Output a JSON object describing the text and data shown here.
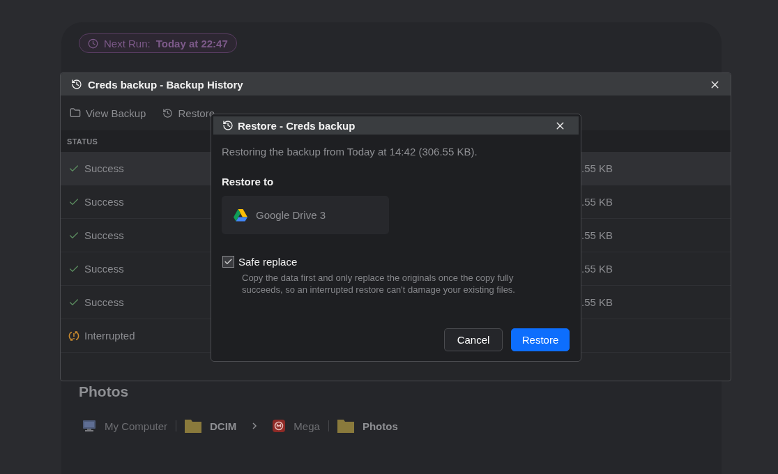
{
  "background": {
    "next_run": {
      "label": "Next Run:",
      "value": "Today at 22:47"
    },
    "section_title": "Photos",
    "breadcrumb": [
      {
        "kind": "computer",
        "label": "My Computer"
      },
      {
        "kind": "bar"
      },
      {
        "kind": "folder",
        "label": "DCIM"
      },
      {
        "kind": "chevron"
      },
      {
        "kind": "mega",
        "label": "Mega"
      },
      {
        "kind": "bar"
      },
      {
        "kind": "folder",
        "label": "Photos"
      }
    ]
  },
  "history_window": {
    "title": "Creds backup - Backup History",
    "toolbar": [
      {
        "kind": "folder",
        "label": "View Backup"
      },
      {
        "kind": "history",
        "label": "Restore"
      }
    ],
    "column_header": "STATUS",
    "rows": [
      {
        "kind": "success",
        "label": "Success",
        "size": ".55 KB",
        "selected": true
      },
      {
        "kind": "success",
        "label": "Success",
        "size": ".55 KB",
        "selected": false
      },
      {
        "kind": "success",
        "label": "Success",
        "size": ".55 KB",
        "selected": false
      },
      {
        "kind": "success",
        "label": "Success",
        "size": ".55 KB",
        "selected": false
      },
      {
        "kind": "success",
        "label": "Success",
        "size": ".55 KB",
        "selected": false
      },
      {
        "kind": "interrupted",
        "label": "Interrupted",
        "selected": false
      }
    ]
  },
  "dialog": {
    "title": "Restore - Creds backup",
    "message": "Restoring the backup from Today at 14:42 (306.55 KB).",
    "restore_to_label": "Restore to",
    "target": {
      "label": "Google Drive 3"
    },
    "safe_replace": {
      "label": "Safe replace",
      "description": "Copy the data first and only replace the originals once the copy fully succeeds, so an interrupted restore can't damage your existing files.",
      "checked": true
    },
    "buttons": [
      {
        "label": "Cancel",
        "kind": "secondary"
      },
      {
        "label": "Restore",
        "kind": "primary"
      }
    ]
  }
}
